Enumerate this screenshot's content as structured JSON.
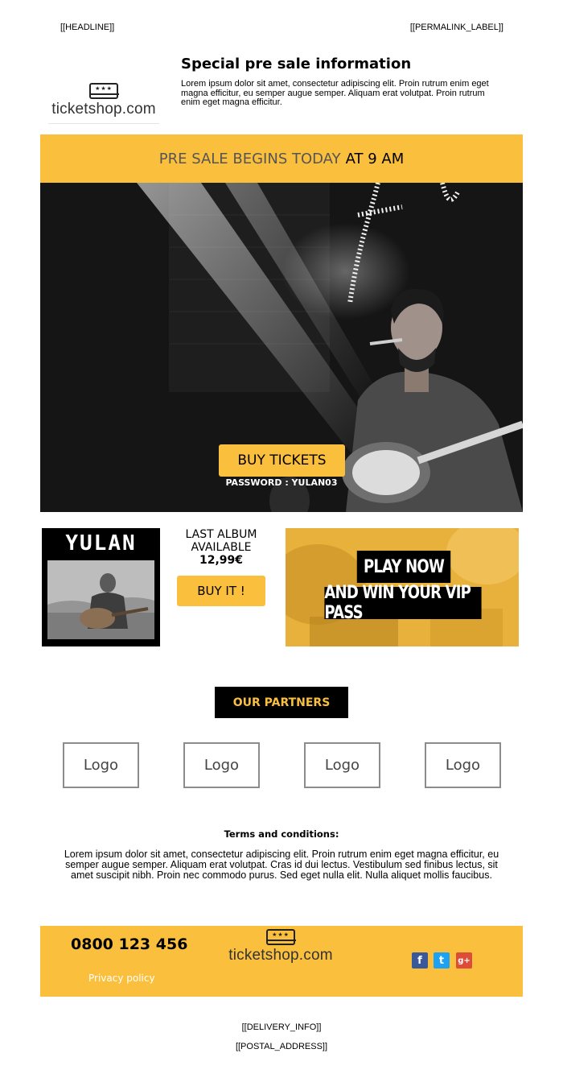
{
  "header": {
    "headline": "[[HEADLINE]]",
    "permalink": "[[PERMALINK_LABEL]]",
    "brand_name": "ticketshop.com",
    "title": "Special pre sale information",
    "description": "Lorem ipsum dolor sit amet, consectetur adipiscing elit. Proin rutrum enim eget magna efficitur, eu semper augue semper. Aliquam erat volutpat. Proin rutrum enim eget magna efficitur."
  },
  "banner": {
    "part1": "PRE SALE BEGINS TODAY",
    "part2": "AT 9 AM"
  },
  "hero": {
    "button_label": "BUY TICKETS",
    "password": "PASSWORD : YULAN03"
  },
  "album": {
    "cover_title": "YULAN",
    "line1": "LAST ALBUM",
    "line2": "AVAILABLE",
    "price": "12,99€",
    "button_label": "BUY IT !"
  },
  "promo": {
    "line1": "PLAY NOW",
    "line2": "AND WIN YOUR VIP PASS"
  },
  "partners": {
    "title": "OUR PARTNERS",
    "logos": [
      "Logo",
      "Logo",
      "Logo",
      "Logo"
    ]
  },
  "terms": {
    "title": "Terms and conditions:",
    "text": "Lorem ipsum dolor sit amet, consectetur adipiscing elit. Proin rutrum enim eget magna efficitur, eu semper augue semper. Aliquam erat volutpat. Cras id dui lectus. Vestibulum sed finibus lectus, sit amet suscipit nibh. Proin nec commodo purus. Sed eget nulla elit. Nulla aliquet mollis faucibus."
  },
  "footer": {
    "phone": "0800 123 456",
    "privacy": "Privacy policy",
    "brand_name": "ticketshop.com",
    "social": {
      "facebook": "f",
      "twitter": "t",
      "googleplus": "g+"
    }
  },
  "bottom": {
    "delivery": "[[DELIVERY_INFO]]",
    "postal": "[[POSTAL_ADDRESS]]"
  },
  "colors": {
    "accent": "#fbbf3e",
    "dark": "#000000"
  }
}
